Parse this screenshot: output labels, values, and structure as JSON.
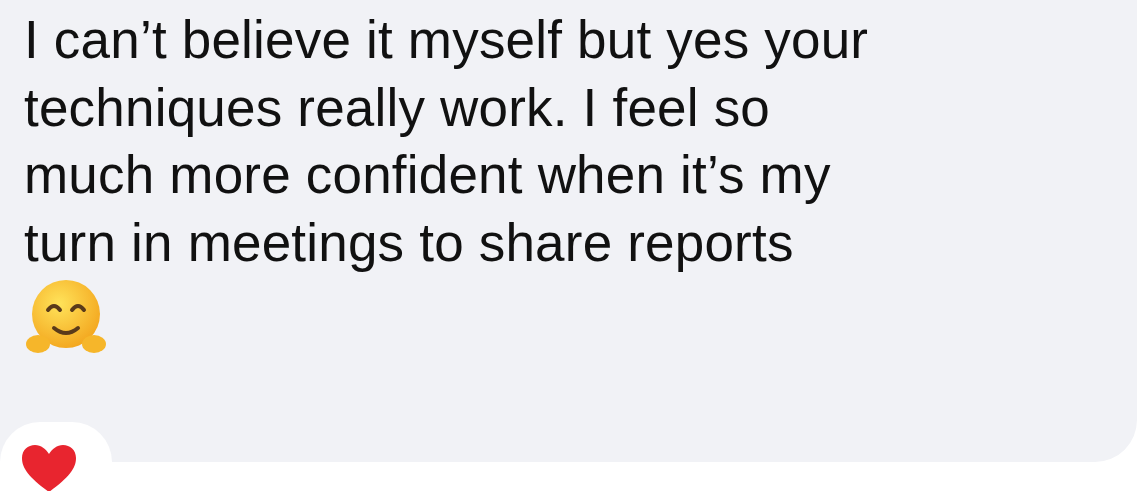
{
  "message": {
    "lines": [
      "I can’t believe it myself but yes your",
      "techniques really work. I feel so",
      "much more confident when it’s my",
      "turn in meetings to share reports"
    ]
  },
  "reaction": {
    "kind": "heart"
  }
}
